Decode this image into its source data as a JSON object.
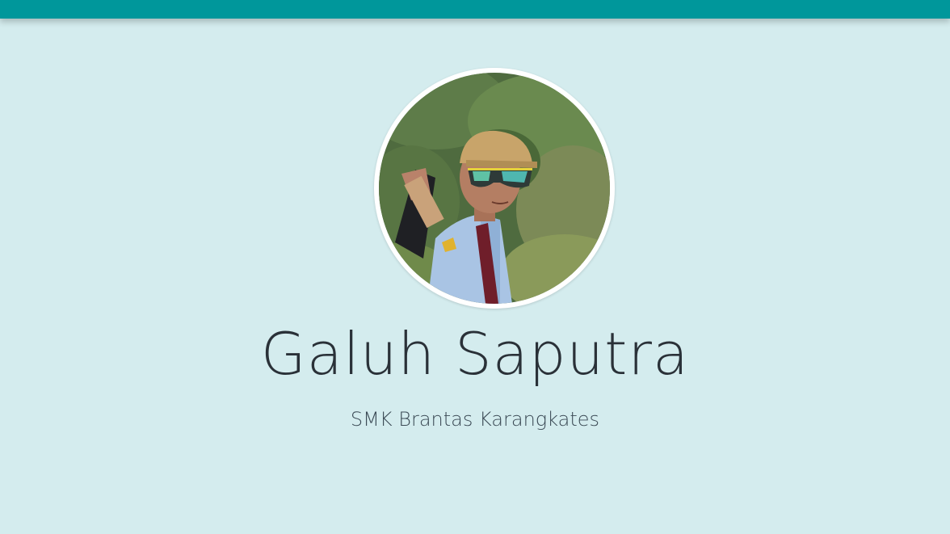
{
  "header": {
    "color": "#00979b"
  },
  "profile": {
    "name": "Galuh Saputra",
    "school": "SMK Brantas Karangkates",
    "avatar_icon": "profile-photo"
  },
  "colors": {
    "background": "#d4ecee",
    "text_primary": "#2a3138",
    "text_secondary": "#3b4a55"
  }
}
